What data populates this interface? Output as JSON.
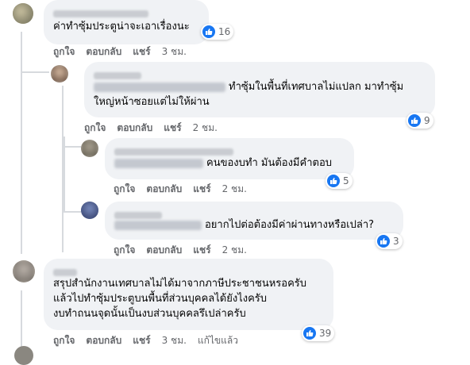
{
  "comments": [
    {
      "text": "ค่าทำซุ้มประตูน่าจะเอาเรื่องนะ",
      "reactions": "16",
      "actions": {
        "like": "ถูกใจ",
        "reply": "ตอบกลับ",
        "share": "แชร์",
        "time": "3 ชม."
      }
    },
    {
      "text_line1": "ทำซุ้มในพื้นที่เทศบาลไม่แปลก มาทำซุ้ม",
      "text_line2": "ใหญ่หน้าซอยแต่ไม่ให้ผ่าน",
      "reactions": "9",
      "actions": {
        "like": "ถูกใจ",
        "reply": "ตอบกลับ",
        "share": "แชร์",
        "time": "2 ชม."
      }
    },
    {
      "text": "คนของบทำ มันต้องมีคำตอบ",
      "reactions": "5",
      "actions": {
        "like": "ถูกใจ",
        "reply": "ตอบกลับ",
        "share": "แชร์",
        "time": "2 ชม."
      }
    },
    {
      "text": "อยากไปต่อต้องมีค่าผ่านทางหรือเปล่า?",
      "reactions": "3",
      "actions": {
        "like": "ถูกใจ",
        "reply": "ตอบกลับ",
        "share": "แชร์",
        "time": "2 ชม."
      }
    },
    {
      "text_line1": "สรุปสำนักงานเทศบาลไม่ได้มาจากภาษีประชาชนหรอครับ",
      "text_line2": "แล้วไปทำซุ้มประตูบนพื้นที่ส่วนบุคคลได้ยังไงครับ",
      "text_line3": "งบทำถนนจุดนั้นเป็นงบส่วนบุคคลรึเปล่าครับ",
      "reactions": "39",
      "actions": {
        "like": "ถูกใจ",
        "reply": "ตอบกลับ",
        "share": "แชร์",
        "time": "3 ชม.",
        "edited": "แก้ไขแล้ว"
      }
    }
  ],
  "colors": {
    "like_blue": "#1877f2",
    "bubble": "#f0f2f5",
    "meta": "#65676b"
  },
  "icons": {
    "reaction": "like-thumb-icon"
  }
}
